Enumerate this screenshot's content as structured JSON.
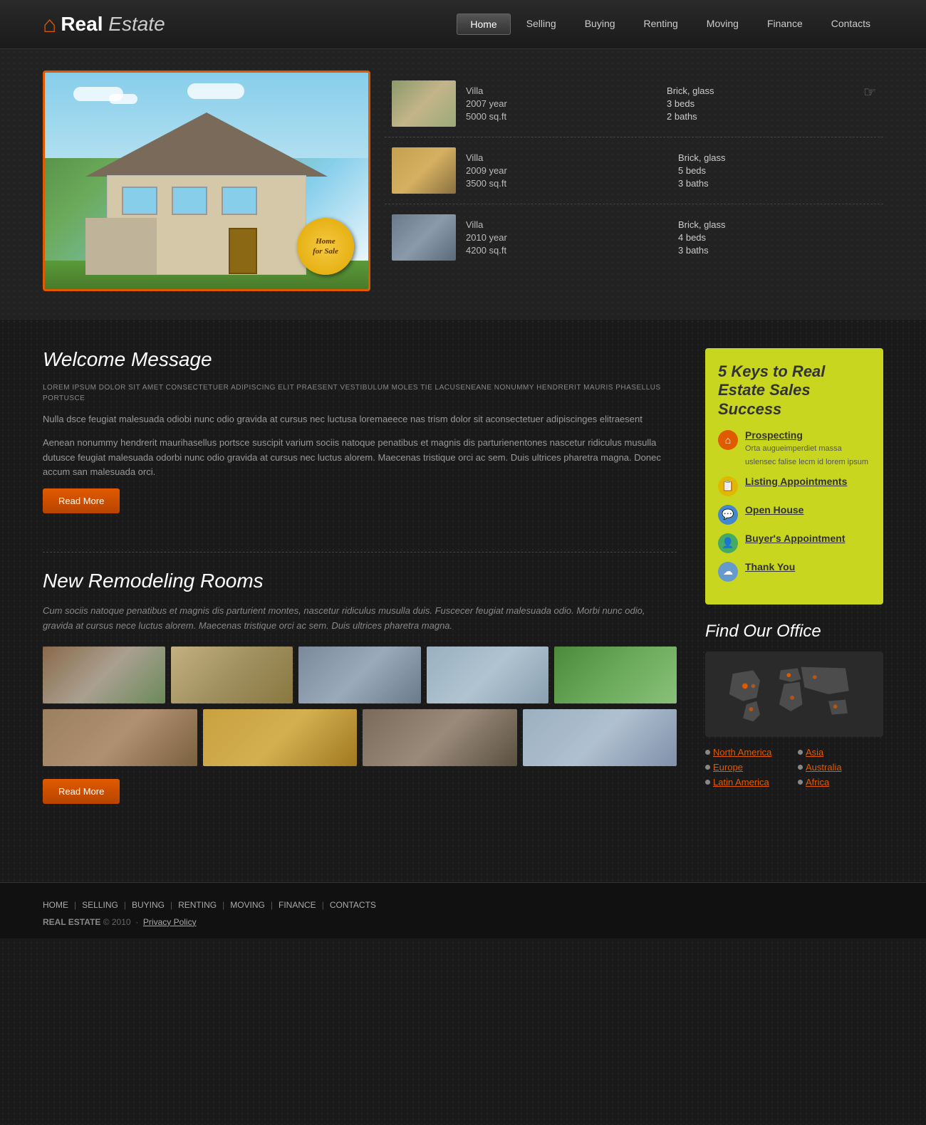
{
  "header": {
    "logo_real": "Real",
    "logo_estate": "Estate",
    "nav": [
      {
        "label": "Home",
        "active": true
      },
      {
        "label": "Selling",
        "active": false
      },
      {
        "label": "Buying",
        "active": false
      },
      {
        "label": "Renting",
        "active": false
      },
      {
        "label": "Moving",
        "active": false
      },
      {
        "label": "Finance",
        "active": false
      },
      {
        "label": "Contacts",
        "active": false
      }
    ]
  },
  "hero": {
    "badge_line1": "Home",
    "badge_line2": "for Sale"
  },
  "properties": [
    {
      "type": "Villa",
      "year": "2007 year",
      "sqft": "5000 sq.ft",
      "material": "Brick, glass",
      "beds": "3 beds",
      "baths": "2 baths"
    },
    {
      "type": "Villa",
      "year": "2009 year",
      "sqft": "3500 sq.ft",
      "material": "Brick, glass",
      "beds": "5 beds",
      "baths": "3 baths"
    },
    {
      "type": "Villa",
      "year": "2010 year",
      "sqft": "4200 sq.ft",
      "material": "Brick, glass",
      "beds": "4 beds",
      "baths": "3 baths"
    }
  ],
  "welcome": {
    "title": "Welcome Message",
    "intro_upper": "LOREM IPSUM DOLOR SIT AMET CONSECTETUER ADIPISCING ELIT PRAESENT VESTIBULUM MOLES TIE LACUSENEANE NONUMMY HENDRERIT MAURIS PHASELLUS PORTUSCE",
    "intro_normal": "Nulla dsce feugiat malesuada odiobi nunc odio gravida at cursus nec luctusa loremaeece nas trism dolor sit aconsectetuer adipiscinges elitraesent",
    "intro_detail": "Aenean nonummy hendrerit maurihasellus portsce suscipit varium sociis natoque penatibus et magnis dis parturienentones nascetur ridiculus musulla dutusce feugiat malesuada odorbi nunc odio gravida at cursus nec luctus alorem. Maecenas tristique orci ac sem. Duis ultrices pharetra magna. Donec accum san malesuada orci.",
    "read_more": "Read More"
  },
  "remodeling": {
    "title": "New Remodeling Rooms",
    "text": "Cum sociis natoque penatibus et magnis dis parturient montes, nascetur ridiculus musulla duis. Fuscecer feugiat malesuada odio. Morbi nunc odio, gravida at cursus nece luctus alorem. Maecenas tristique orci ac sem. Duis ultrices pharetra magna.",
    "read_more": "Read More",
    "photos_row1": [
      "ph1",
      "ph2",
      "ph3",
      "ph4",
      "ph5"
    ],
    "photos_row2": [
      "ph6",
      "ph7",
      "ph8",
      "ph9"
    ]
  },
  "keys": {
    "title": "5 Keys to Real Estate Sales Success",
    "items": [
      {
        "label": "Prospecting",
        "desc": "Orta augueimperdiet massa uslensec falise lecm id lorem ipsum",
        "icon_type": "orange"
      },
      {
        "label": "Listing Appointments",
        "desc": "",
        "icon_type": "yellow"
      },
      {
        "label": "Open House",
        "desc": "",
        "icon_type": "blue"
      },
      {
        "label": "Buyer's Appointment",
        "desc": "",
        "icon_type": "green2"
      },
      {
        "label": "Thank You",
        "desc": "",
        "icon_type": "lightblue"
      }
    ]
  },
  "office": {
    "title": "Find Our Office",
    "locations": [
      {
        "label": "North America",
        "col": 1
      },
      {
        "label": "Asia",
        "col": 2
      },
      {
        "label": "Europe",
        "col": 1
      },
      {
        "label": "Australia",
        "col": 2
      },
      {
        "label": "Latin America",
        "col": 1
      },
      {
        "label": "Africa",
        "col": 2
      }
    ]
  },
  "footer": {
    "nav_items": [
      "HOME",
      "SELLING",
      "BUYING",
      "RENTING",
      "MOVING",
      "FINANCE",
      "CONTACTS"
    ],
    "copy": "REAL ESTATE",
    "year": "© 2010",
    "privacy": "Privacy Policy"
  }
}
